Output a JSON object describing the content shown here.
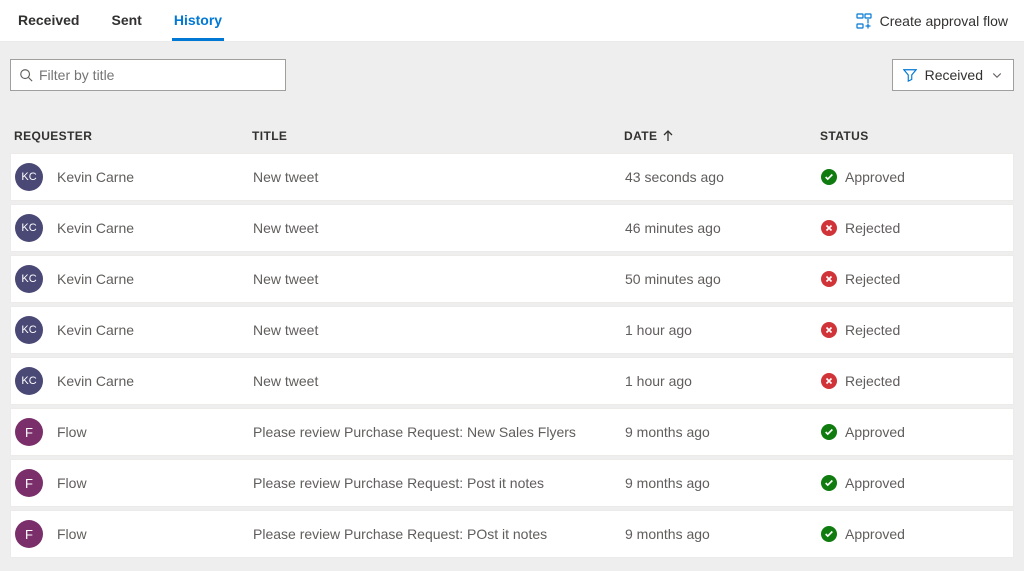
{
  "tabs": {
    "received": "Received",
    "sent": "Sent",
    "history": "History",
    "active": "history"
  },
  "create_link": "Create approval flow",
  "search": {
    "placeholder": "Filter by title",
    "value": ""
  },
  "filter_button": {
    "label": "Received"
  },
  "columns": {
    "requester": "REQUESTER",
    "title": "TITLE",
    "date": "DATE",
    "status": "STATUS",
    "sort_column": "date",
    "sort_dir": "asc"
  },
  "rows": [
    {
      "initials": "KC",
      "avatar_kind": "kc",
      "requester": "Kevin Carne",
      "title": "New tweet",
      "date": "43 seconds ago",
      "status": "Approved",
      "status_kind": "approved"
    },
    {
      "initials": "KC",
      "avatar_kind": "kc",
      "requester": "Kevin Carne",
      "title": "New tweet",
      "date": "46 minutes ago",
      "status": "Rejected",
      "status_kind": "rejected"
    },
    {
      "initials": "KC",
      "avatar_kind": "kc",
      "requester": "Kevin Carne",
      "title": "New tweet",
      "date": "50 minutes ago",
      "status": "Rejected",
      "status_kind": "rejected"
    },
    {
      "initials": "KC",
      "avatar_kind": "kc",
      "requester": "Kevin Carne",
      "title": "New tweet",
      "date": "1 hour ago",
      "status": "Rejected",
      "status_kind": "rejected"
    },
    {
      "initials": "KC",
      "avatar_kind": "kc",
      "requester": "Kevin Carne",
      "title": "New tweet",
      "date": "1 hour ago",
      "status": "Rejected",
      "status_kind": "rejected"
    },
    {
      "initials": "F",
      "avatar_kind": "flow",
      "requester": "Flow",
      "title": "Please review Purchase Request: New Sales Flyers",
      "date": "9 months ago",
      "status": "Approved",
      "status_kind": "approved"
    },
    {
      "initials": "F",
      "avatar_kind": "flow",
      "requester": "Flow",
      "title": "Please review Purchase Request: Post it notes",
      "date": "9 months ago",
      "status": "Approved",
      "status_kind": "approved"
    },
    {
      "initials": "F",
      "avatar_kind": "flow",
      "requester": "Flow",
      "title": "Please review Purchase Request: POst it notes",
      "date": "9 months ago",
      "status": "Approved",
      "status_kind": "approved"
    }
  ]
}
